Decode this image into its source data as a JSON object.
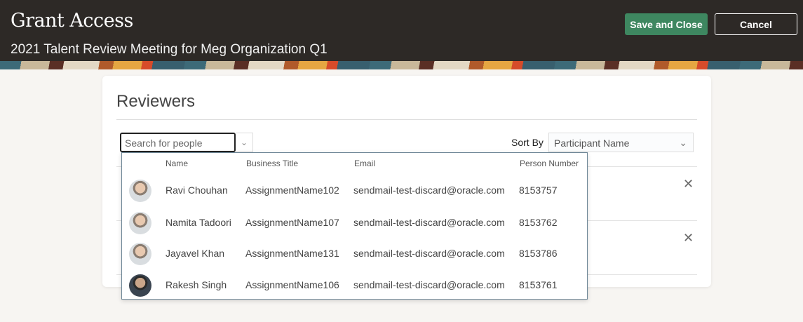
{
  "header": {
    "title": "Grant Access",
    "subtitle": "2021 Talent Review Meeting for Meg Organization Q1",
    "save_label": "Save and Close",
    "cancel_label": "Cancel"
  },
  "reviewers": {
    "title": "Reviewers",
    "search_placeholder": "Search for people",
    "sort_label": "Sort By",
    "sort_value": "Participant Name"
  },
  "dropdown": {
    "columns": [
      "Name",
      "Business Title",
      "Email",
      "Person Number"
    ],
    "rows": [
      {
        "name": "Ravi Chouhan",
        "title": "AssignmentName102",
        "email": "sendmail-test-discard@oracle.com",
        "number": "8153757"
      },
      {
        "name": "Namita Tadoori",
        "title": "AssignmentName107",
        "email": "sendmail-test-discard@oracle.com",
        "number": "8153762"
      },
      {
        "name": "Jayavel Khan",
        "title": "AssignmentName131",
        "email": "sendmail-test-discard@oracle.com",
        "number": "8153786"
      },
      {
        "name": "Rakesh Singh",
        "title": "AssignmentName106",
        "email": "sendmail-test-discard@oracle.com",
        "number": "8153761"
      }
    ]
  }
}
